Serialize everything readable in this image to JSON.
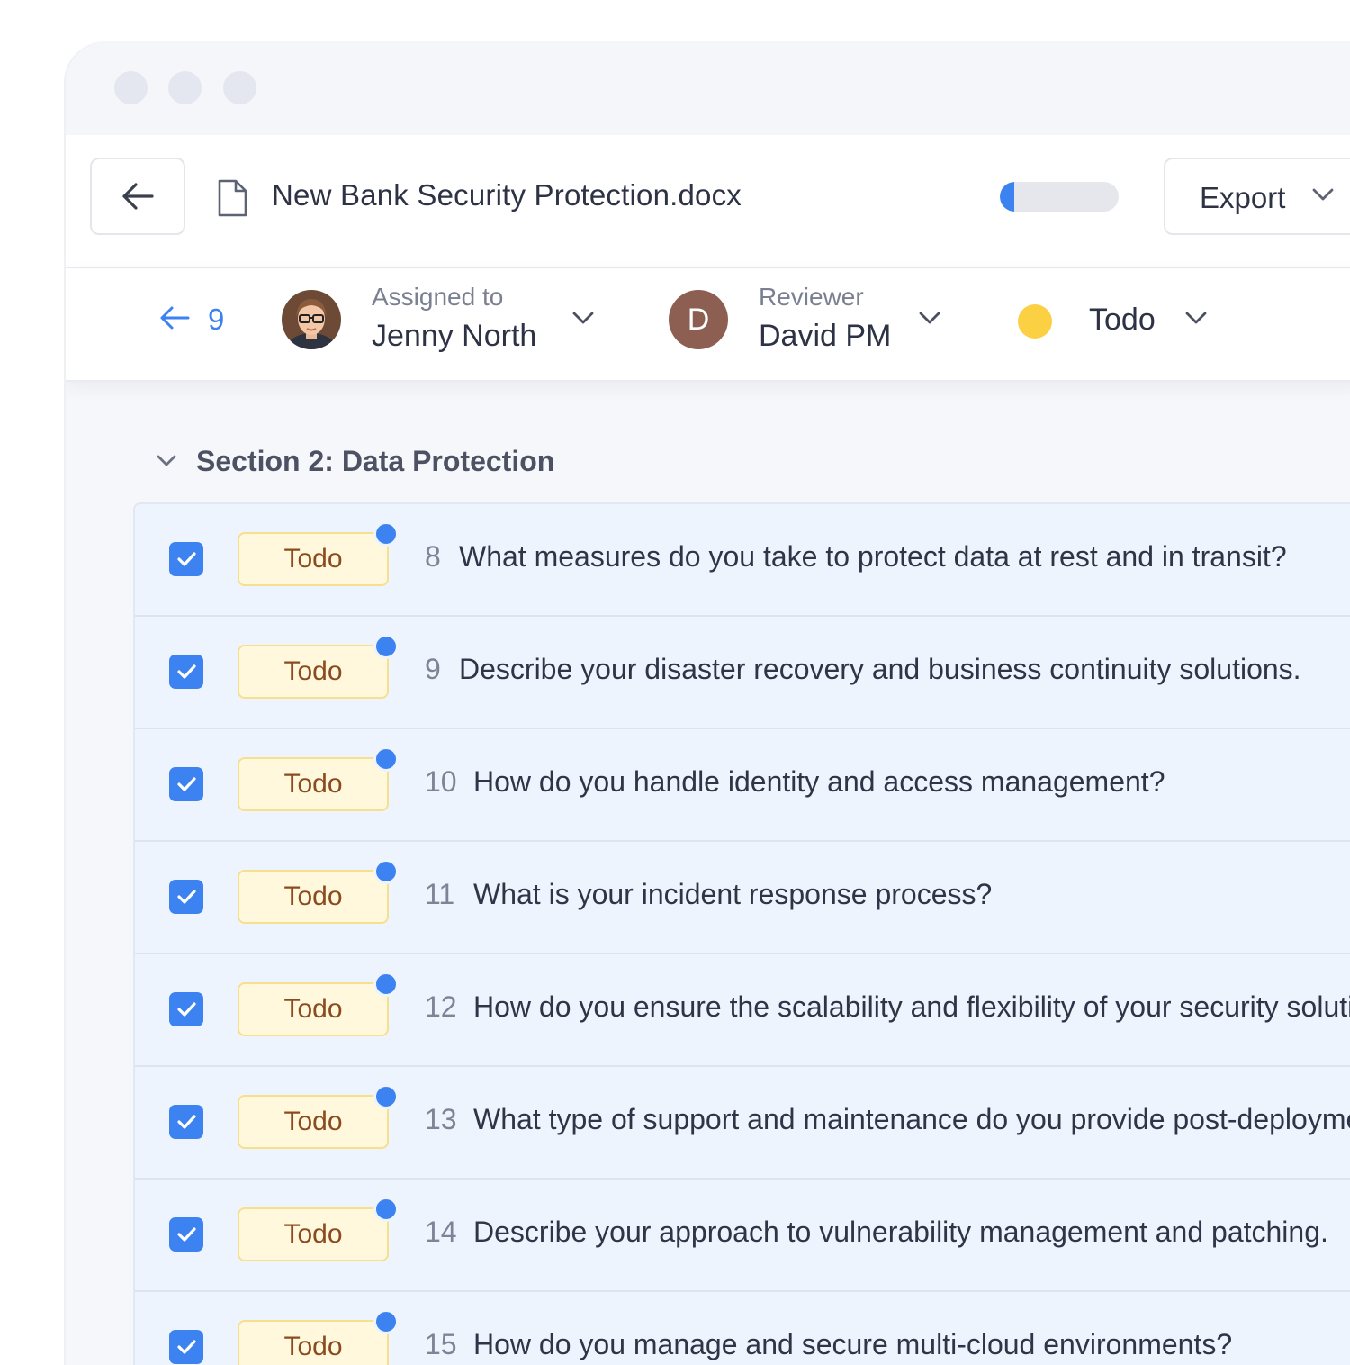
{
  "colors": {
    "accent": "#3c82f0",
    "status_todo_bg": "#fff8dc",
    "status_todo_text": "#8a4c1f",
    "status_dot": "#fbd043",
    "reviewer_avatar": "#8d5f52"
  },
  "toolbar": {
    "back_icon": "arrow-left-icon",
    "document_icon": "document-icon",
    "document_title": "New Bank Security Protection.docx",
    "progress_fraction": 0.12,
    "export_label": "Export"
  },
  "meta": {
    "nav_count": "9",
    "assigned_caption": "Assigned to",
    "assigned_name": "Jenny North",
    "reviewer_caption": "Reviewer",
    "reviewer_initial": "D",
    "reviewer_name": "David PM",
    "status_label": "Todo"
  },
  "section": {
    "title": "Section 2: Data Protection"
  },
  "questions": [
    {
      "num": "8",
      "status": "Todo",
      "text": "What measures do you take to protect data at rest and in transit?"
    },
    {
      "num": "9",
      "status": "Todo",
      "text": "Describe your disaster recovery and business continuity solutions."
    },
    {
      "num": "10",
      "status": "Todo",
      "text": "How do you handle identity and access management?"
    },
    {
      "num": "11",
      "status": "Todo",
      "text": "What is your incident response process?"
    },
    {
      "num": "12",
      "status": "Todo",
      "text": "How do you ensure the scalability and flexibility of your security solutions?"
    },
    {
      "num": "13",
      "status": "Todo",
      "text": "What type of support and maintenance do you provide post-deployment?"
    },
    {
      "num": "14",
      "status": "Todo",
      "text": "Describe your approach to vulnerability management and patching."
    },
    {
      "num": "15",
      "status": "Todo",
      "text": "How do you manage and secure multi-cloud environments?"
    }
  ]
}
